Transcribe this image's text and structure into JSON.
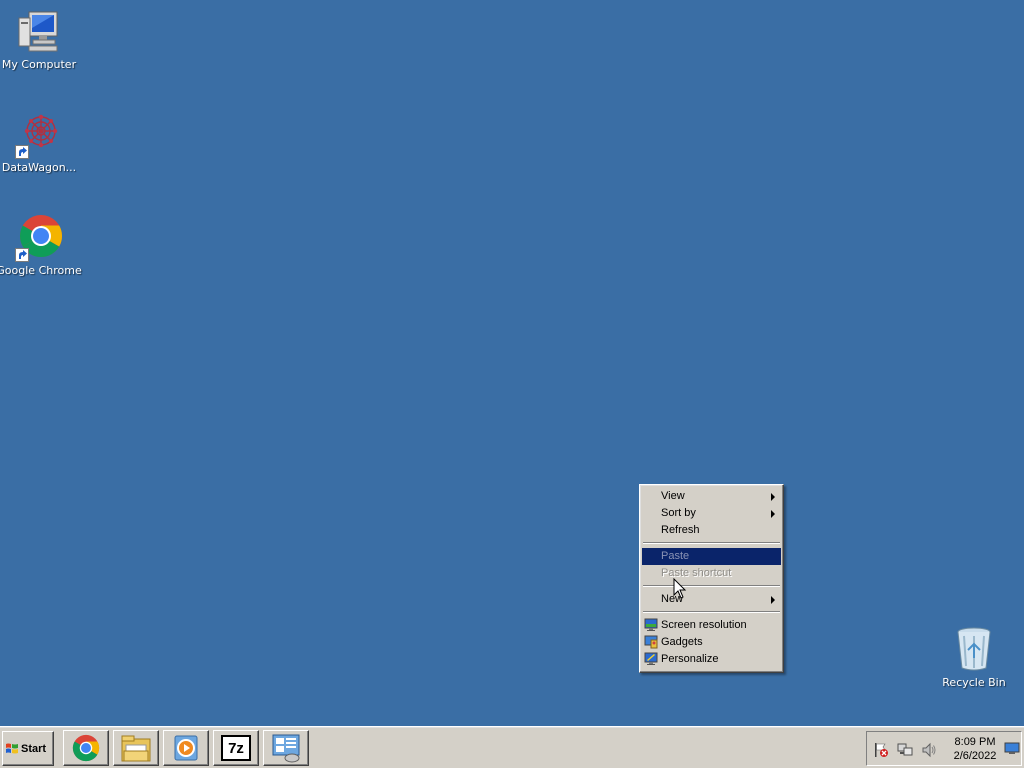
{
  "desktop": {
    "background_color": "#3a6ea5",
    "icons": [
      {
        "label": "My Computer",
        "icon": "computer-icon"
      },
      {
        "label": "DataWagon...",
        "icon": "datawagon-icon"
      },
      {
        "label": "Google Chrome",
        "icon": "chrome-icon"
      },
      {
        "label": "Recycle Bin",
        "icon": "recycle-bin-icon"
      }
    ]
  },
  "context_menu": {
    "items": [
      {
        "label": "View",
        "submenu": true
      },
      {
        "label": "Sort by",
        "submenu": true
      },
      {
        "label": "Refresh"
      },
      {
        "label": "Paste",
        "disabled": true,
        "highlighted": true
      },
      {
        "label": "Paste shortcut",
        "disabled": true
      },
      {
        "label": "New",
        "submenu": true
      },
      {
        "label": "Screen resolution",
        "icon": "screen-resolution-icon"
      },
      {
        "label": "Gadgets",
        "icon": "gadgets-icon"
      },
      {
        "label": "Personalize",
        "icon": "personalize-icon"
      }
    ]
  },
  "taskbar": {
    "start_label": "Start",
    "pinned": [
      {
        "name": "Google Chrome",
        "icon": "chrome-icon"
      },
      {
        "name": "Windows Explorer",
        "icon": "folder-icon"
      },
      {
        "name": "Media Player",
        "icon": "media-player-icon"
      },
      {
        "name": "7-Zip",
        "icon": "7zip-icon",
        "text": "7z"
      },
      {
        "name": "Server Manager",
        "icon": "server-manager-icon"
      }
    ],
    "tray": {
      "icons": [
        "action-center-flag-icon",
        "network-icon",
        "volume-icon",
        "show-desktop-icon"
      ],
      "time": "8:09 PM",
      "date": "2/6/2022"
    }
  }
}
